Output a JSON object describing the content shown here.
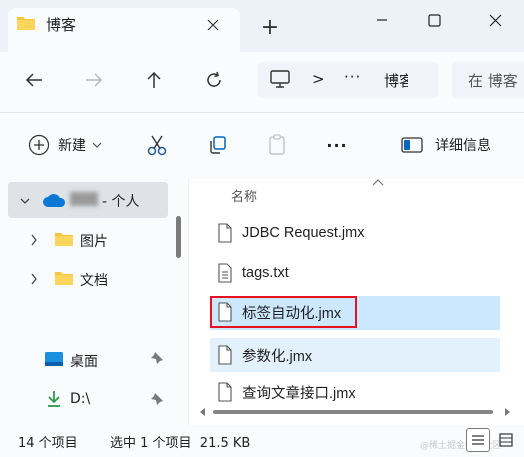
{
  "window": {
    "tab_title": "博客",
    "tab_close_icon": "close-icon",
    "new_tab_label": "+"
  },
  "navigation": {
    "address_chevron": ">",
    "address_ellipsis": "···",
    "address_folder": "博客",
    "search_placeholder": "在 博客"
  },
  "commandbar": {
    "new_label": "新建",
    "more_label": "···",
    "details_label": "详细信息"
  },
  "sidebar": {
    "onedrive_label": "- 个人",
    "items": [
      {
        "label": "图片",
        "icon": "folder-icon"
      },
      {
        "label": "文档",
        "icon": "folder-icon"
      },
      {
        "label": "桌面",
        "icon": "desktop-icon"
      },
      {
        "label": "D:\\",
        "icon": "download-icon"
      }
    ]
  },
  "filelist": {
    "column_name": "名称",
    "files": [
      {
        "name": "JDBC Request.jmx",
        "state": "normal"
      },
      {
        "name": "tags.txt",
        "state": "normal"
      },
      {
        "name": "标签自动化.jmx",
        "state": "selected-focused"
      },
      {
        "name": "参数化.jmx",
        "state": "selected"
      },
      {
        "name": "查询文章接口.jmx",
        "state": "normal"
      }
    ]
  },
  "status": {
    "item_count": "14 个项目",
    "selection": "选中 1 个项目  21.5 KB"
  },
  "watermark": "@稀土掘金技术社区",
  "colors": {
    "accent": "#0067c0",
    "selection": "#cce8ff",
    "selected_row": "#d9ecfb",
    "focus_border": "#e81123",
    "folder": "#f8c63a"
  }
}
